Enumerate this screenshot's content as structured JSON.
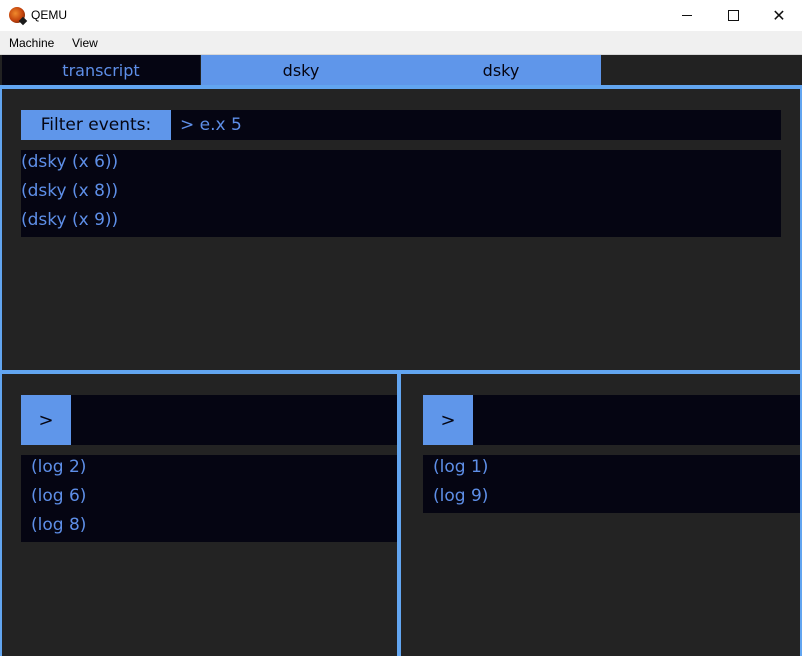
{
  "window": {
    "title": "QEMU"
  },
  "menu": {
    "items": [
      {
        "label": "Machine"
      },
      {
        "label": "View"
      }
    ]
  },
  "tabs": [
    {
      "label": "transcript",
      "active": false
    },
    {
      "label": "dsky",
      "active": true
    },
    {
      "label": "dsky",
      "active": true
    }
  ],
  "filter": {
    "label": "Filter events:",
    "value": "> e.x 5"
  },
  "events": [
    "(dsky (x 6))",
    "(dsky (x 8))",
    "(dsky (x 9))"
  ],
  "left_pane": {
    "prompt_label": ">",
    "input_value": "",
    "logs": [
      "(log 2)",
      "(log 6)",
      "(log 8)"
    ]
  },
  "right_pane": {
    "prompt_label": ">",
    "input_value": "",
    "logs": [
      "(log 1)",
      "(log 9)"
    ]
  },
  "colors": {
    "accent": "#5f96ea",
    "divider": "#62a5f0",
    "dark": "#050512",
    "background": "#232323",
    "text": "#5e8fe8"
  }
}
